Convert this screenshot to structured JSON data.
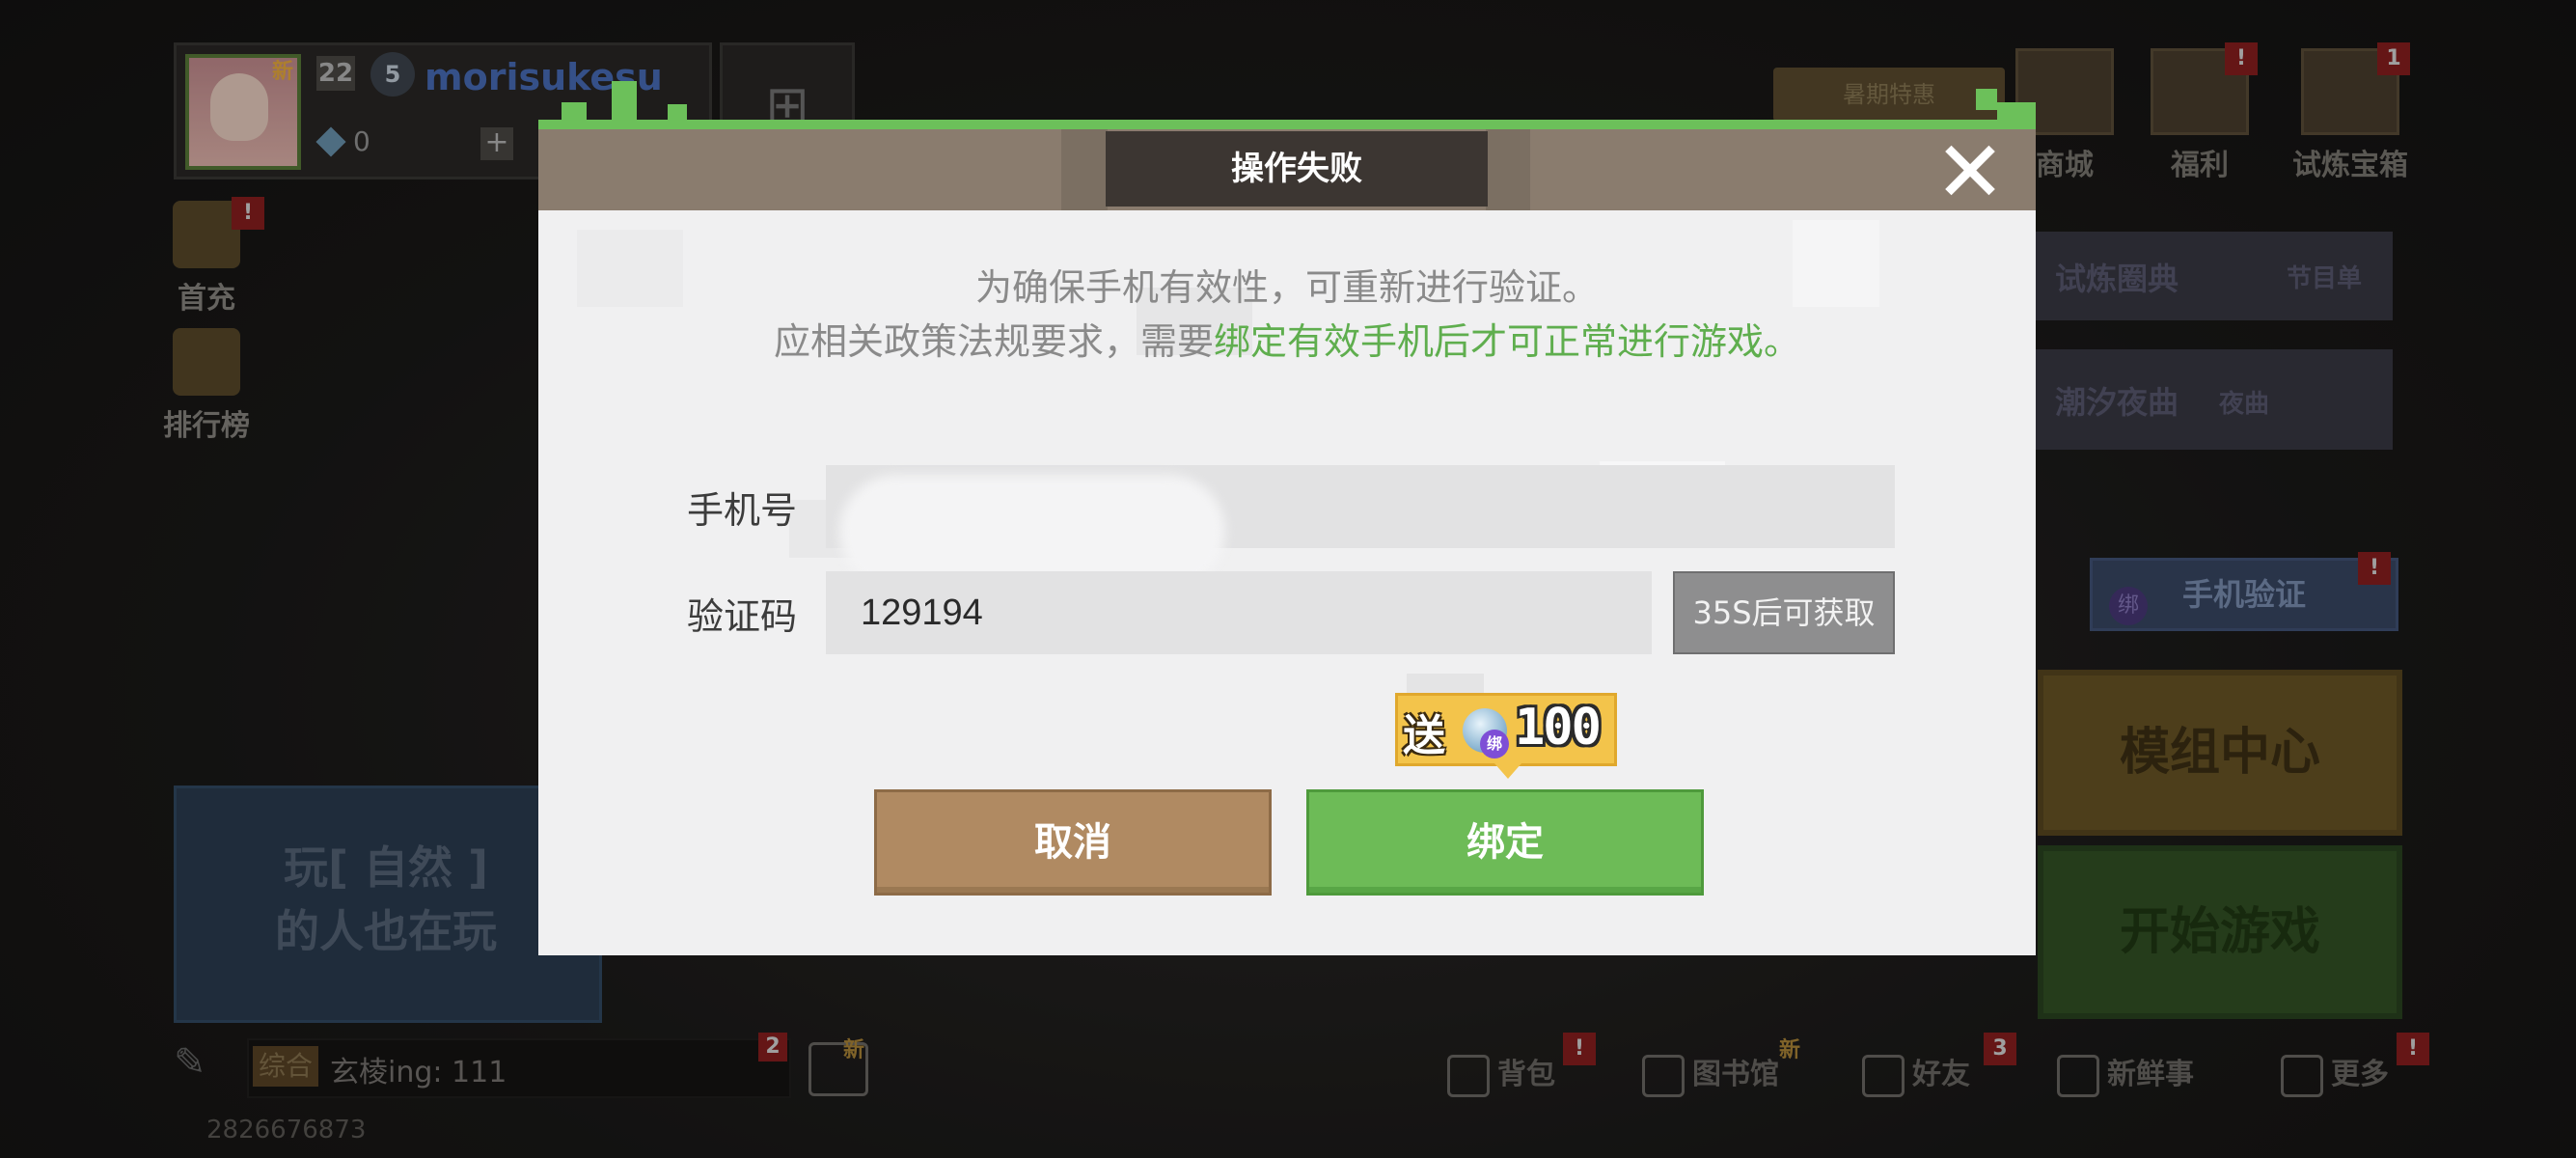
{
  "background": {
    "profile": {
      "new_tag": "新",
      "level": "22",
      "vip": "5",
      "username": "morisukesu",
      "diamonds": "0",
      "plus": "+"
    },
    "top_menu": [
      {
        "label": "商城"
      },
      {
        "label": "福利",
        "badge": "!"
      },
      {
        "label": "试炼宝箱",
        "badge": "1"
      }
    ],
    "promo_pill": "暑期特惠",
    "left_menu": [
      {
        "label": "首充",
        "badge": "!"
      },
      {
        "label": "排行榜"
      }
    ],
    "banners": [
      {
        "text": "试炼圈典",
        "sub": "节目单"
      },
      {
        "text": "潮汐夜曲",
        "sub": "夜曲"
      }
    ],
    "phone_verify": "手机验证",
    "phone_verify_badge": "!",
    "phone_verify_bind": "绑",
    "mod_center": "模组中心",
    "start_game": "开始游戏",
    "recommend_text_1": "玩[ 自然 ]",
    "recommend_text_2": "的人也在玩",
    "chat": {
      "tag": "综合",
      "message": "玄棱ing: 111",
      "badge": "2",
      "new_tag": "新"
    },
    "uid": "2826676873",
    "bottom_nav": [
      {
        "label": "背包",
        "badge": "!"
      },
      {
        "label": "图书馆",
        "badge": "新"
      },
      {
        "label": "好友",
        "badge": "3"
      },
      {
        "label": "新鲜事"
      },
      {
        "label": "更多",
        "badge": "!"
      }
    ]
  },
  "dialog": {
    "title": "操作失败",
    "notice_line1": "为确保手机有效性，可重新进行验证。",
    "notice_line2_plain": "应相关政策法规要求，需要",
    "notice_line2_highlight": "绑定有效手机后才可正常进行游戏。",
    "phone_label": "手机号",
    "phone_value": "",
    "code_label": "验证码",
    "code_value": "129194",
    "get_code_label": "35S后可获取",
    "reward_send": "送",
    "reward_bind": "绑",
    "reward_amount": "100",
    "cancel_label": "取消",
    "bind_label": "绑定"
  },
  "colors": {
    "accent_green": "#6dbb57",
    "highlight_text_green": "#5fae4e",
    "cancel_brown": "#b08a62",
    "titlebar": "#8a7c6e",
    "reward_gold": "#f3c44b"
  },
  "icons": [
    "close-icon",
    "diamond-icon",
    "add-friend-icon",
    "chat-icon",
    "backpack-icon",
    "library-icon",
    "friends-icon",
    "news-icon",
    "more-icon"
  ]
}
